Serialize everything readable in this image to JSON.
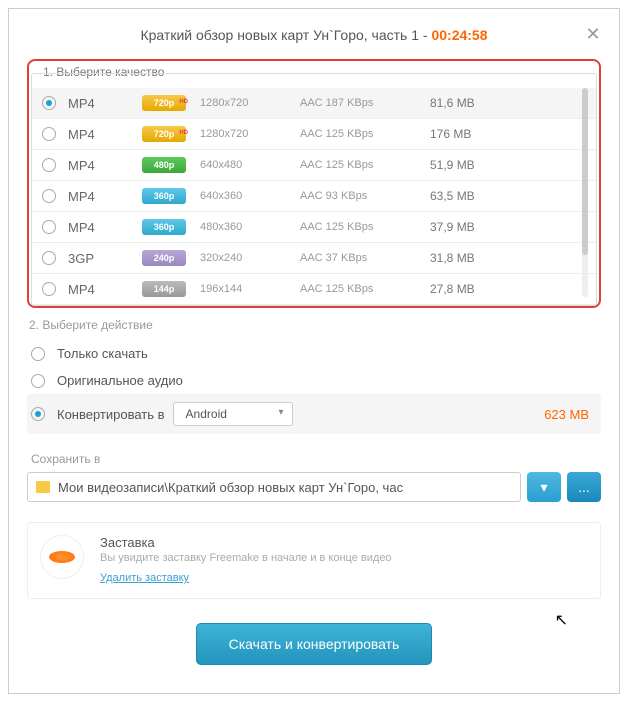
{
  "header": {
    "title": "Краткий обзор новых карт Ун`Горо, часть 1 - ",
    "duration": "00:24:58"
  },
  "section1": {
    "title": "1. Выберите качество",
    "rows": [
      {
        "format": "MP4",
        "icon": "",
        "badge": "720p",
        "badgeClass": "badge-720 badge-hd",
        "res": "1280x720",
        "audio": "AAC 187  KBps",
        "size": "81,6 MB",
        "selected": true
      },
      {
        "format": "MP4",
        "icon": "",
        "badge": "720p",
        "badgeClass": "badge-720 badge-hd",
        "res": "1280x720",
        "audio": "AAC 125  KBps",
        "size": "176 MB",
        "selected": false
      },
      {
        "format": "MP4",
        "icon": "",
        "badge": "480p",
        "badgeClass": "badge-480",
        "res": "640x480",
        "audio": "AAC 125  KBps",
        "size": "51,9 MB",
        "selected": false
      },
      {
        "format": "MP4",
        "icon": "apple",
        "badge": "360p",
        "badgeClass": "badge-360",
        "res": "640x360",
        "audio": "AAC 93  KBps",
        "size": "63,5 MB",
        "selected": false
      },
      {
        "format": "MP4",
        "icon": "",
        "badge": "360p",
        "badgeClass": "badge-360",
        "res": "480x360",
        "audio": "AAC 125  KBps",
        "size": "37,9 MB",
        "selected": false
      },
      {
        "format": "3GP",
        "icon": "",
        "badge": "240p",
        "badgeClass": "badge-240",
        "res": "320x240",
        "audio": "AAC 37  KBps",
        "size": "31,8 MB",
        "selected": false
      },
      {
        "format": "MP4",
        "icon": "",
        "badge": "144p",
        "badgeClass": "badge-144",
        "res": "196x144",
        "audio": "AAC 125  KBps",
        "size": "27,8 MB",
        "selected": false
      }
    ]
  },
  "section2": {
    "title": "2. Выберите действие",
    "actions": {
      "download_only": "Только скачать",
      "original_audio": "Оригинальное аудио",
      "convert_to": "Конвертировать в",
      "convert_target": "Android",
      "convert_size": "623 MB"
    }
  },
  "save": {
    "label": "Сохранить в",
    "path": "Мои видеозаписи\\Краткий обзор новых карт Ун`Горо, час",
    "dots": "..."
  },
  "promo": {
    "title": "Заставка",
    "desc": "Вы увидите заставку Freemake в начале и в конце видео",
    "link": "Удалить заставку"
  },
  "main_button": "Скачать и конвертировать"
}
